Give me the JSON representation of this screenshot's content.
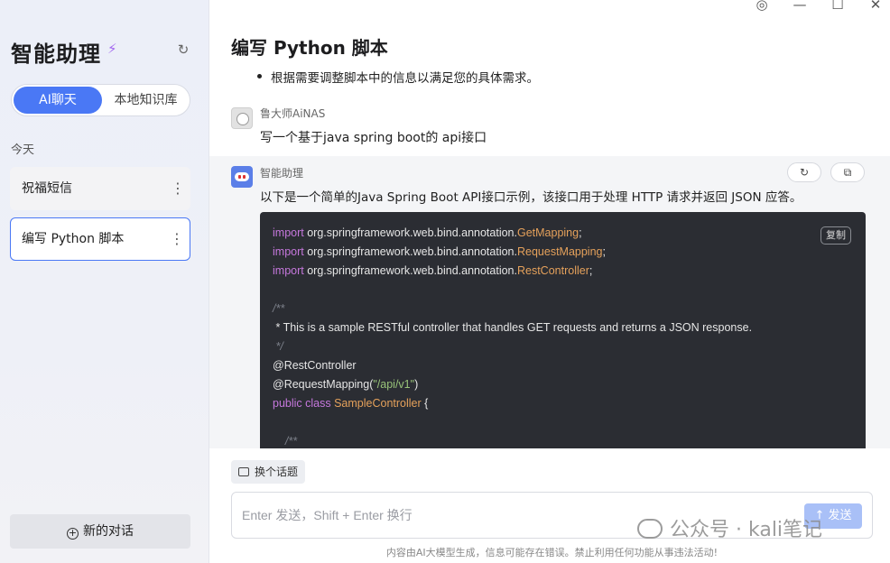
{
  "sidebar": {
    "title": "智能助理",
    "tabs": {
      "active": "AI聊天",
      "inactive": "本地知识库"
    },
    "section_label": "今天",
    "conversations": [
      {
        "label": "祝福短信"
      },
      {
        "label": "编写 Python 脚本"
      }
    ],
    "more_glyph": "⋮",
    "new_chat_label": "新的对话"
  },
  "window_controls": {
    "settings": "◎",
    "minimize": "—",
    "maximize": "☐",
    "close": "✕"
  },
  "main": {
    "title": "编写 Python 脚本",
    "bullet": "根据需要调整脚本中的信息以满足您的具体需求。",
    "user_message": {
      "sender": "鲁大师AiNAS",
      "text": "写一个基于java spring boot的 api接口"
    },
    "bot_message": {
      "sender": "智能助理",
      "intro": "以下是一个简单的Java Spring Boot API接口示例，该接口用于处理 HTTP 请求并返回 JSON 应答。",
      "copy_label": "复制",
      "code": {
        "l1_kw": "import",
        "l1_pkg": " org.springframework.web.bind.annotation.",
        "l1_cls": "GetMapping",
        "l1_end": ";",
        "l2_kw": "import",
        "l2_pkg": " org.springframework.web.bind.annotation.",
        "l2_cls": "RequestMapping",
        "l2_end": ";",
        "l3_kw": "import",
        "l3_pkg": " org.springframework.web.bind.annotation.",
        "l3_cls": "RestController",
        "l3_end": ";",
        "c1": "/**",
        "c2": " * This is a sample RESTful controller that handles GET requests and returns a JSON response.",
        "c3": " */",
        "a1": "@RestController",
        "a2_pre": "@RequestMapping(",
        "a2_str": "\"/api/v1\"",
        "a2_post": ")",
        "d_kw": "public class",
        "d_cls": " SampleController",
        "d_end": " {",
        "c4": "    /**"
      }
    }
  },
  "topic_button_label": "换个话题",
  "input": {
    "placeholder": "Enter 发送，Shift + Enter 换行",
    "send_label": "↑ 发送"
  },
  "disclaimer": "内容由AI大模型生成，信息可能存在错误。禁止利用任何功能从事违法活动!",
  "watermark": "公众号 · kali笔记",
  "icons": {
    "spark": "⚡",
    "refresh": "↻",
    "regenerate": "↻",
    "copy_msg": "⧉"
  },
  "colors": {
    "accent": "#4a78f5",
    "code_bg": "#2b2d33",
    "keyword": "#c678dd",
    "class": "#e5a15b",
    "string": "#98c379"
  }
}
